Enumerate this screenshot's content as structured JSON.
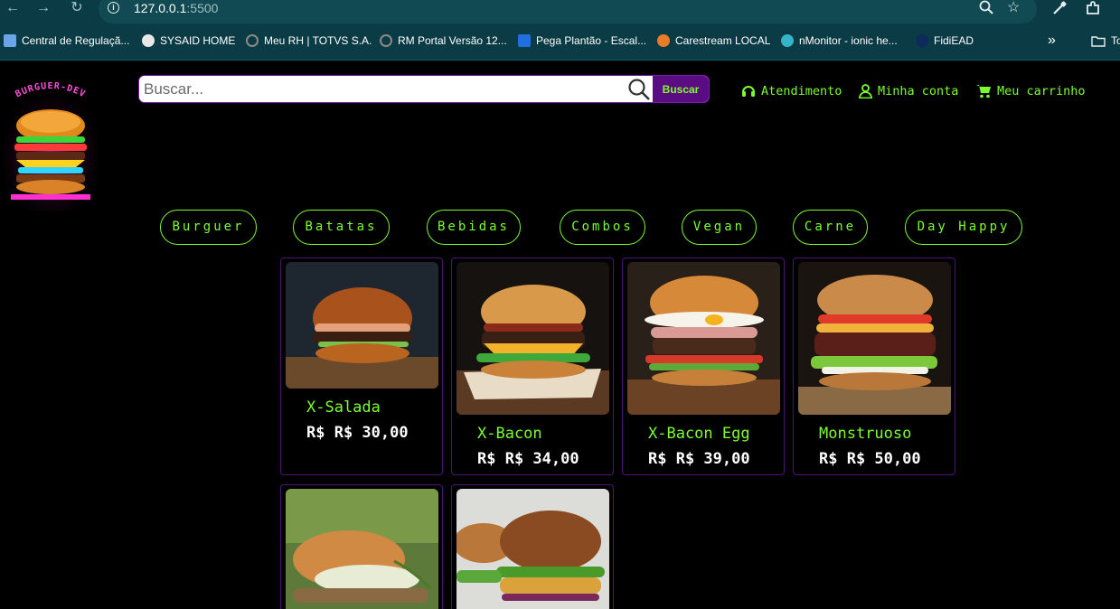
{
  "browser": {
    "url_host": "127.0.0.1",
    "url_port": ":5500",
    "bookmarks": [
      {
        "label": "Central de Regulaçã..."
      },
      {
        "label": "SYSAID HOME"
      },
      {
        "label": "Meu RH | TOTVS S.A."
      },
      {
        "label": "RM Portal Versão 12..."
      },
      {
        "label": "Pega Plantão - Escal..."
      },
      {
        "label": "Carestream LOCAL"
      },
      {
        "label": "nMonitor - ionic he..."
      },
      {
        "label": "FidiEAD"
      },
      {
        "label": "To"
      }
    ],
    "overflow_label": "»"
  },
  "header": {
    "logo_text": "BURGUER-DEV",
    "search": {
      "placeholder": "Buscar...",
      "button_label": "Buscar"
    },
    "nav": {
      "support_label": "Atendimento",
      "account_label": "Minha conta",
      "cart_label": "Meu carrinho"
    }
  },
  "categories": [
    "Burguer",
    "Batatas",
    "Bebidas",
    "Combos",
    "Vegan",
    "Carne",
    "Day Happy"
  ],
  "products": [
    {
      "name": "X-Salada",
      "price": "R$ R$ 30,00"
    },
    {
      "name": "X-Bacon",
      "price": "R$ R$ 34,00"
    },
    {
      "name": "X-Bacon Egg",
      "price": "R$ R$ 39,00"
    },
    {
      "name": "Monstruoso",
      "price": "R$ R$ 50,00"
    },
    {
      "name": "",
      "price": ""
    },
    {
      "name": "",
      "price": ""
    }
  ],
  "colors": {
    "accent_green": "#7cff2a",
    "accent_purple": "#5a0d82",
    "chrome_bg": "#0b3b44"
  }
}
